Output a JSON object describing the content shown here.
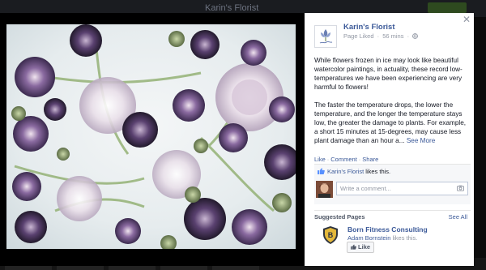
{
  "background_page": {
    "title": "Karin's Florist"
  },
  "photo": {
    "description_icon": "frozen-flowers-photo"
  },
  "post": {
    "page_name": "Karin's Florist",
    "meta_liked": "Page Liked",
    "meta_sep": "·",
    "meta_time": "56 mins",
    "meta_sep2": "·",
    "paragraph1": "While flowers frozen in ice may look like beautiful watercolor paintings, in actuality, these record low-temperatures we have been experiencing are very harmful to flowers!",
    "paragraph2": "The faster the temperature drops, the lower the temperature, and the longer the temperature stays low, the greater the damage to plants. For example, a short 15 minutes at 15-degrees, may cause less plant damage than an hour a...",
    "see_more": "See More",
    "actions": {
      "like": "Like",
      "sep1": "·",
      "comment": "Comment",
      "sep2": "·",
      "share": "Share"
    },
    "likes_liker": "Karin's Florist",
    "likes_suffix": " likes this.",
    "comment_placeholder": "Write a comment..."
  },
  "suggested": {
    "heading": "Suggested Pages",
    "see_all": "See All",
    "page_name": "Born Fitness Consulting",
    "liker": "Adam Bornstein",
    "liker_suffix": " likes this.",
    "like_button": "Like"
  },
  "colors": {
    "link_blue": "#3b5998",
    "muted": "#9197a3",
    "text": "#141823"
  }
}
